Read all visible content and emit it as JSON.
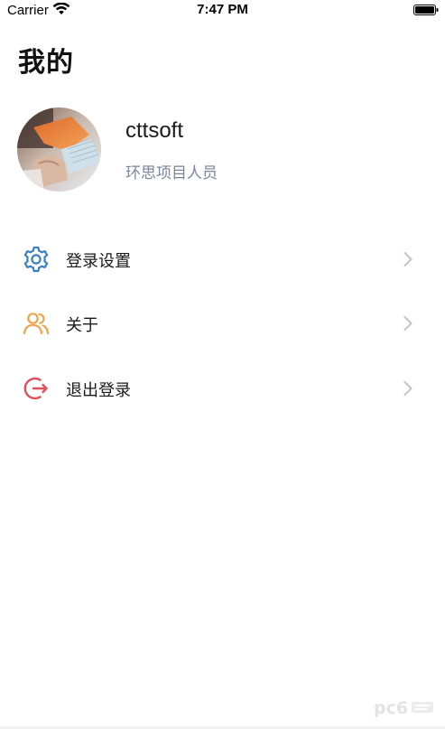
{
  "status_bar": {
    "carrier": "Carrier",
    "time": "7:47 PM",
    "icons": [
      "wifi-icon",
      "battery-icon"
    ]
  },
  "header": {
    "title": "我的"
  },
  "profile": {
    "username": "cttsoft",
    "role": "环思项目人员",
    "avatar": "avatar-photo"
  },
  "menu": {
    "items": [
      {
        "label": "登录设置",
        "icon": "gear-icon",
        "icon_color": "#3a7fc4"
      },
      {
        "label": "关于",
        "icon": "users-icon",
        "icon_color": "#f0a34a"
      },
      {
        "label": "退出登录",
        "icon": "logout-icon",
        "icon_color": "#e0505a"
      }
    ],
    "chevron_color": "#c4c4c8"
  },
  "watermark": {
    "text": "pc6"
  },
  "colors": {
    "background": "#ffffff",
    "text_primary": "#1a1a1a",
    "text_secondary": "#7a8699"
  }
}
